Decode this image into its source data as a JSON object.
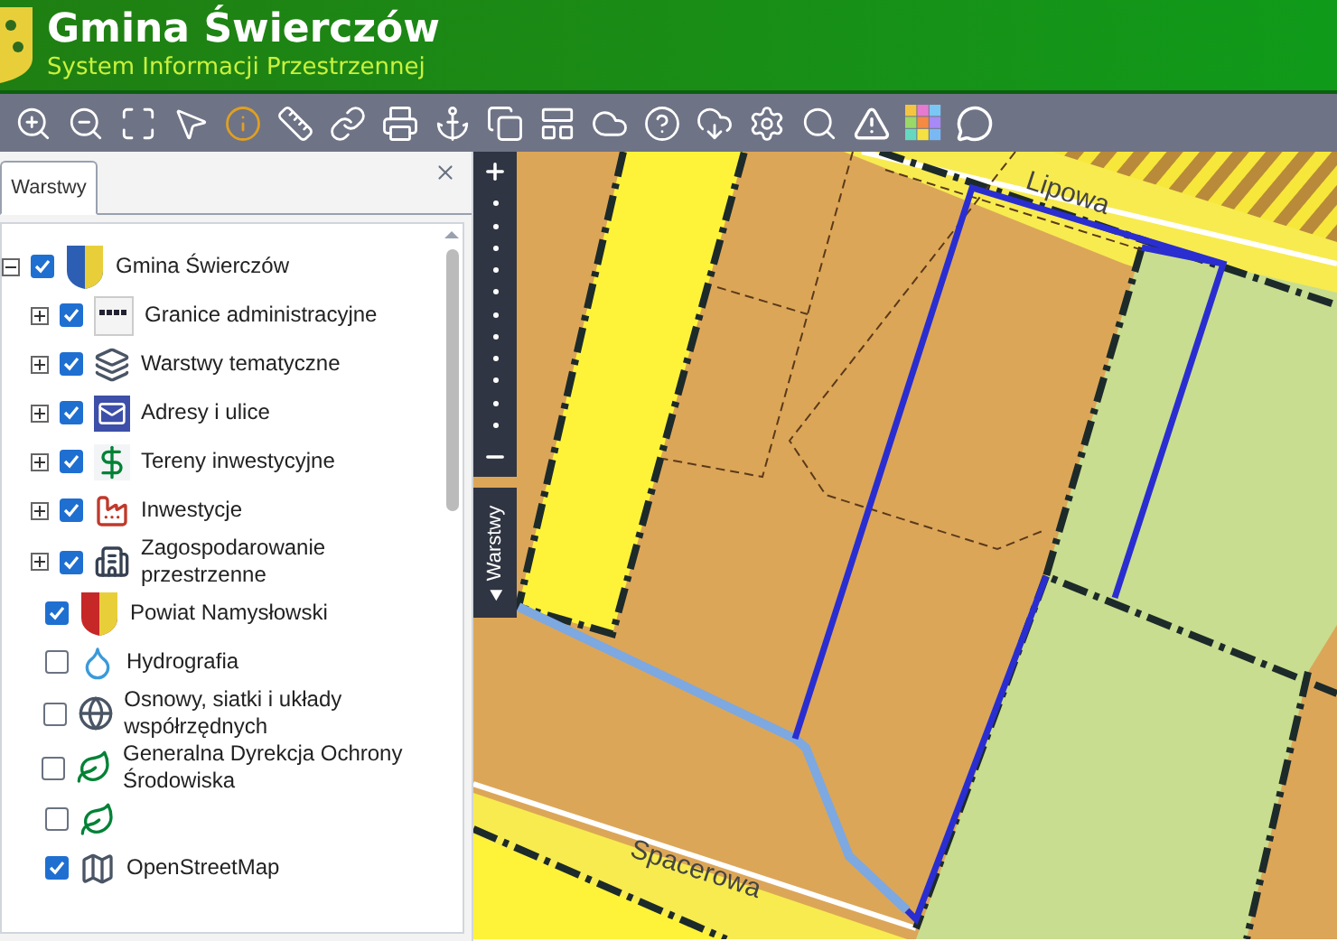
{
  "header": {
    "title": "Gmina Świerczów",
    "subtitle": "System Informacji Przestrzennej"
  },
  "panel": {
    "tabs": [
      {
        "label": "Warstwy",
        "selected": true
      }
    ],
    "layers": [
      {
        "label": "Gmina Świerczów",
        "checked": true,
        "expanded": true,
        "children": [
          {
            "label": "Granice administracyjne",
            "checked": true,
            "expanded": false
          },
          {
            "label": "Warstwy tematyczne",
            "checked": true,
            "expanded": false
          },
          {
            "label": "Adresy i ulice",
            "checked": true,
            "expanded": false
          },
          {
            "label": "Tereny inwestycyjne",
            "checked": true,
            "expanded": false
          },
          {
            "label": "Inwestycje",
            "checked": true,
            "expanded": false
          },
          {
            "label": "Zagospodarowanie przestrzenne",
            "checked": true,
            "expanded": false
          }
        ]
      },
      {
        "label": "Powiat Namysłowski",
        "checked": true
      },
      {
        "label": "Hydrografia",
        "checked": false
      },
      {
        "label": "Osnowy, siatki i układy współrzędnych",
        "checked": false
      },
      {
        "label": "Generalna Dyrekcja Ochrony Środowiska",
        "checked": false
      },
      {
        "checked": false
      },
      {
        "label": "OpenStreetMap",
        "checked": true
      }
    ]
  },
  "map": {
    "side_tab": "Warstwy",
    "streets": [
      {
        "name": "Lipowa"
      },
      {
        "name": "Spacerowa"
      }
    ]
  }
}
